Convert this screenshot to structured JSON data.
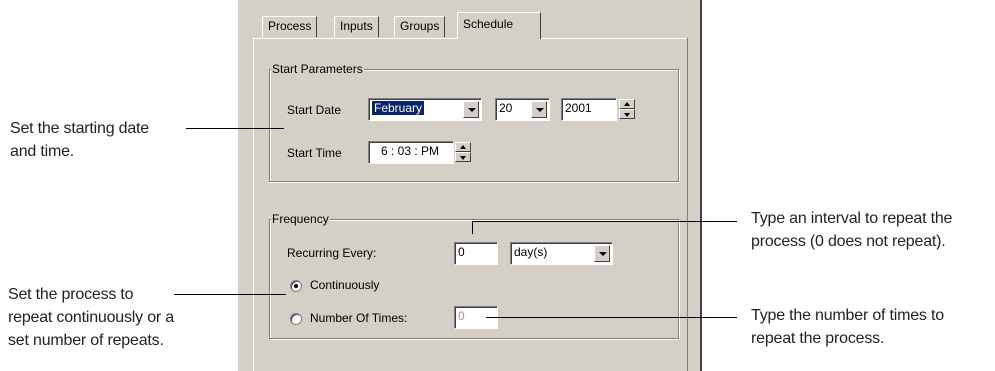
{
  "tabs": [
    {
      "label": "Process"
    },
    {
      "label": "Inputs"
    },
    {
      "label": "Groups"
    },
    {
      "label": "Schedule",
      "active": true
    }
  ],
  "start_parameters": {
    "legend": "Start Parameters",
    "start_date_label": "Start Date",
    "month_value": "February",
    "day_value": "20",
    "year_value": "2001",
    "start_time_label": "Start Time",
    "time_value": "6 : 03 : PM"
  },
  "frequency": {
    "legend": "Frequency",
    "recurring_label": "Recurring Every:",
    "interval_value": "0",
    "unit_value": "day(s)",
    "continuously_label": "Continuously",
    "continuously_selected": true,
    "number_of_times_label": "Number Of Times:",
    "number_of_times_value": "0"
  },
  "callouts": {
    "start_date_time": [
      "Set the starting date",
      "and time."
    ],
    "repeat_mode": [
      "Set the process to",
      "repeat continuously or a",
      "set number of repeats."
    ],
    "interval": [
      "Type an interval to repeat the",
      "process (0 does not repeat)."
    ],
    "number_of_times": [
      "Type the number of times to",
      "repeat the process."
    ]
  },
  "colors": {
    "dialog_bg": "#d4d0c8",
    "selection_bg": "#0a246a"
  }
}
